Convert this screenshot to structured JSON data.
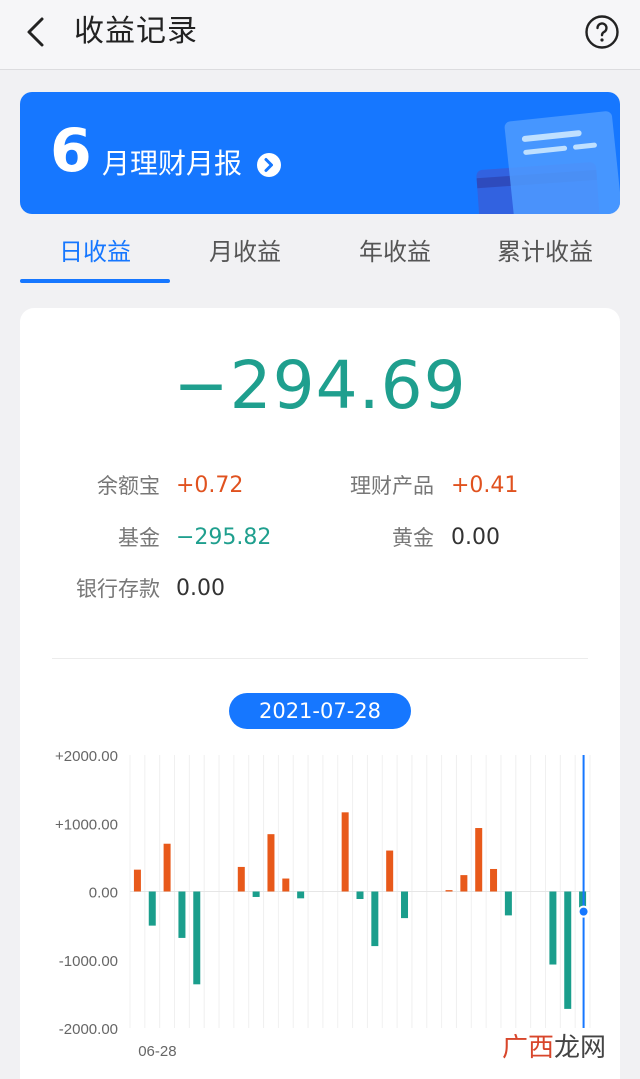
{
  "header": {
    "title": "收益记录"
  },
  "banner": {
    "month_number": "6",
    "label": "月理财月报"
  },
  "tabs": [
    {
      "label": "日收益",
      "active": true
    },
    {
      "label": "月收益",
      "active": false
    },
    {
      "label": "年收益",
      "active": false
    },
    {
      "label": "累计收益",
      "active": false
    }
  ],
  "summary": {
    "total": "−294.69",
    "items": [
      {
        "label": "余额宝",
        "value": "+0.72",
        "sign": "pos"
      },
      {
        "label": "理财产品",
        "value": "+0.41",
        "sign": "pos"
      },
      {
        "label": "基金",
        "value": "−295.82",
        "sign": "neg"
      },
      {
        "label": "黄金",
        "value": "0.00",
        "sign": "zero"
      },
      {
        "label": "银行存款",
        "value": "0.00",
        "sign": "zero"
      }
    ]
  },
  "selected_date": "2021-07-28",
  "chart_data": {
    "type": "bar",
    "ylim": [
      -2000,
      2000
    ],
    "y_ticks": [
      "+2000.00",
      "+1000.00",
      "0.00",
      "-1000.00",
      "-2000.00"
    ],
    "x_tick_labels": [
      "06-28"
    ],
    "positive_color": "#e8591a",
    "negative_color": "#1a9e8c",
    "values": [
      320,
      -500,
      700,
      -680,
      -1360,
      0,
      0,
      360,
      -80,
      840,
      190,
      -100,
      0,
      0,
      1160,
      -110,
      -800,
      600,
      -390,
      0,
      0,
      20,
      240,
      930,
      330,
      -350,
      0,
      0,
      -1070,
      -1720,
      -295
    ]
  },
  "watermark": {
    "part_a": "广西",
    "part_b": "龙网"
  }
}
